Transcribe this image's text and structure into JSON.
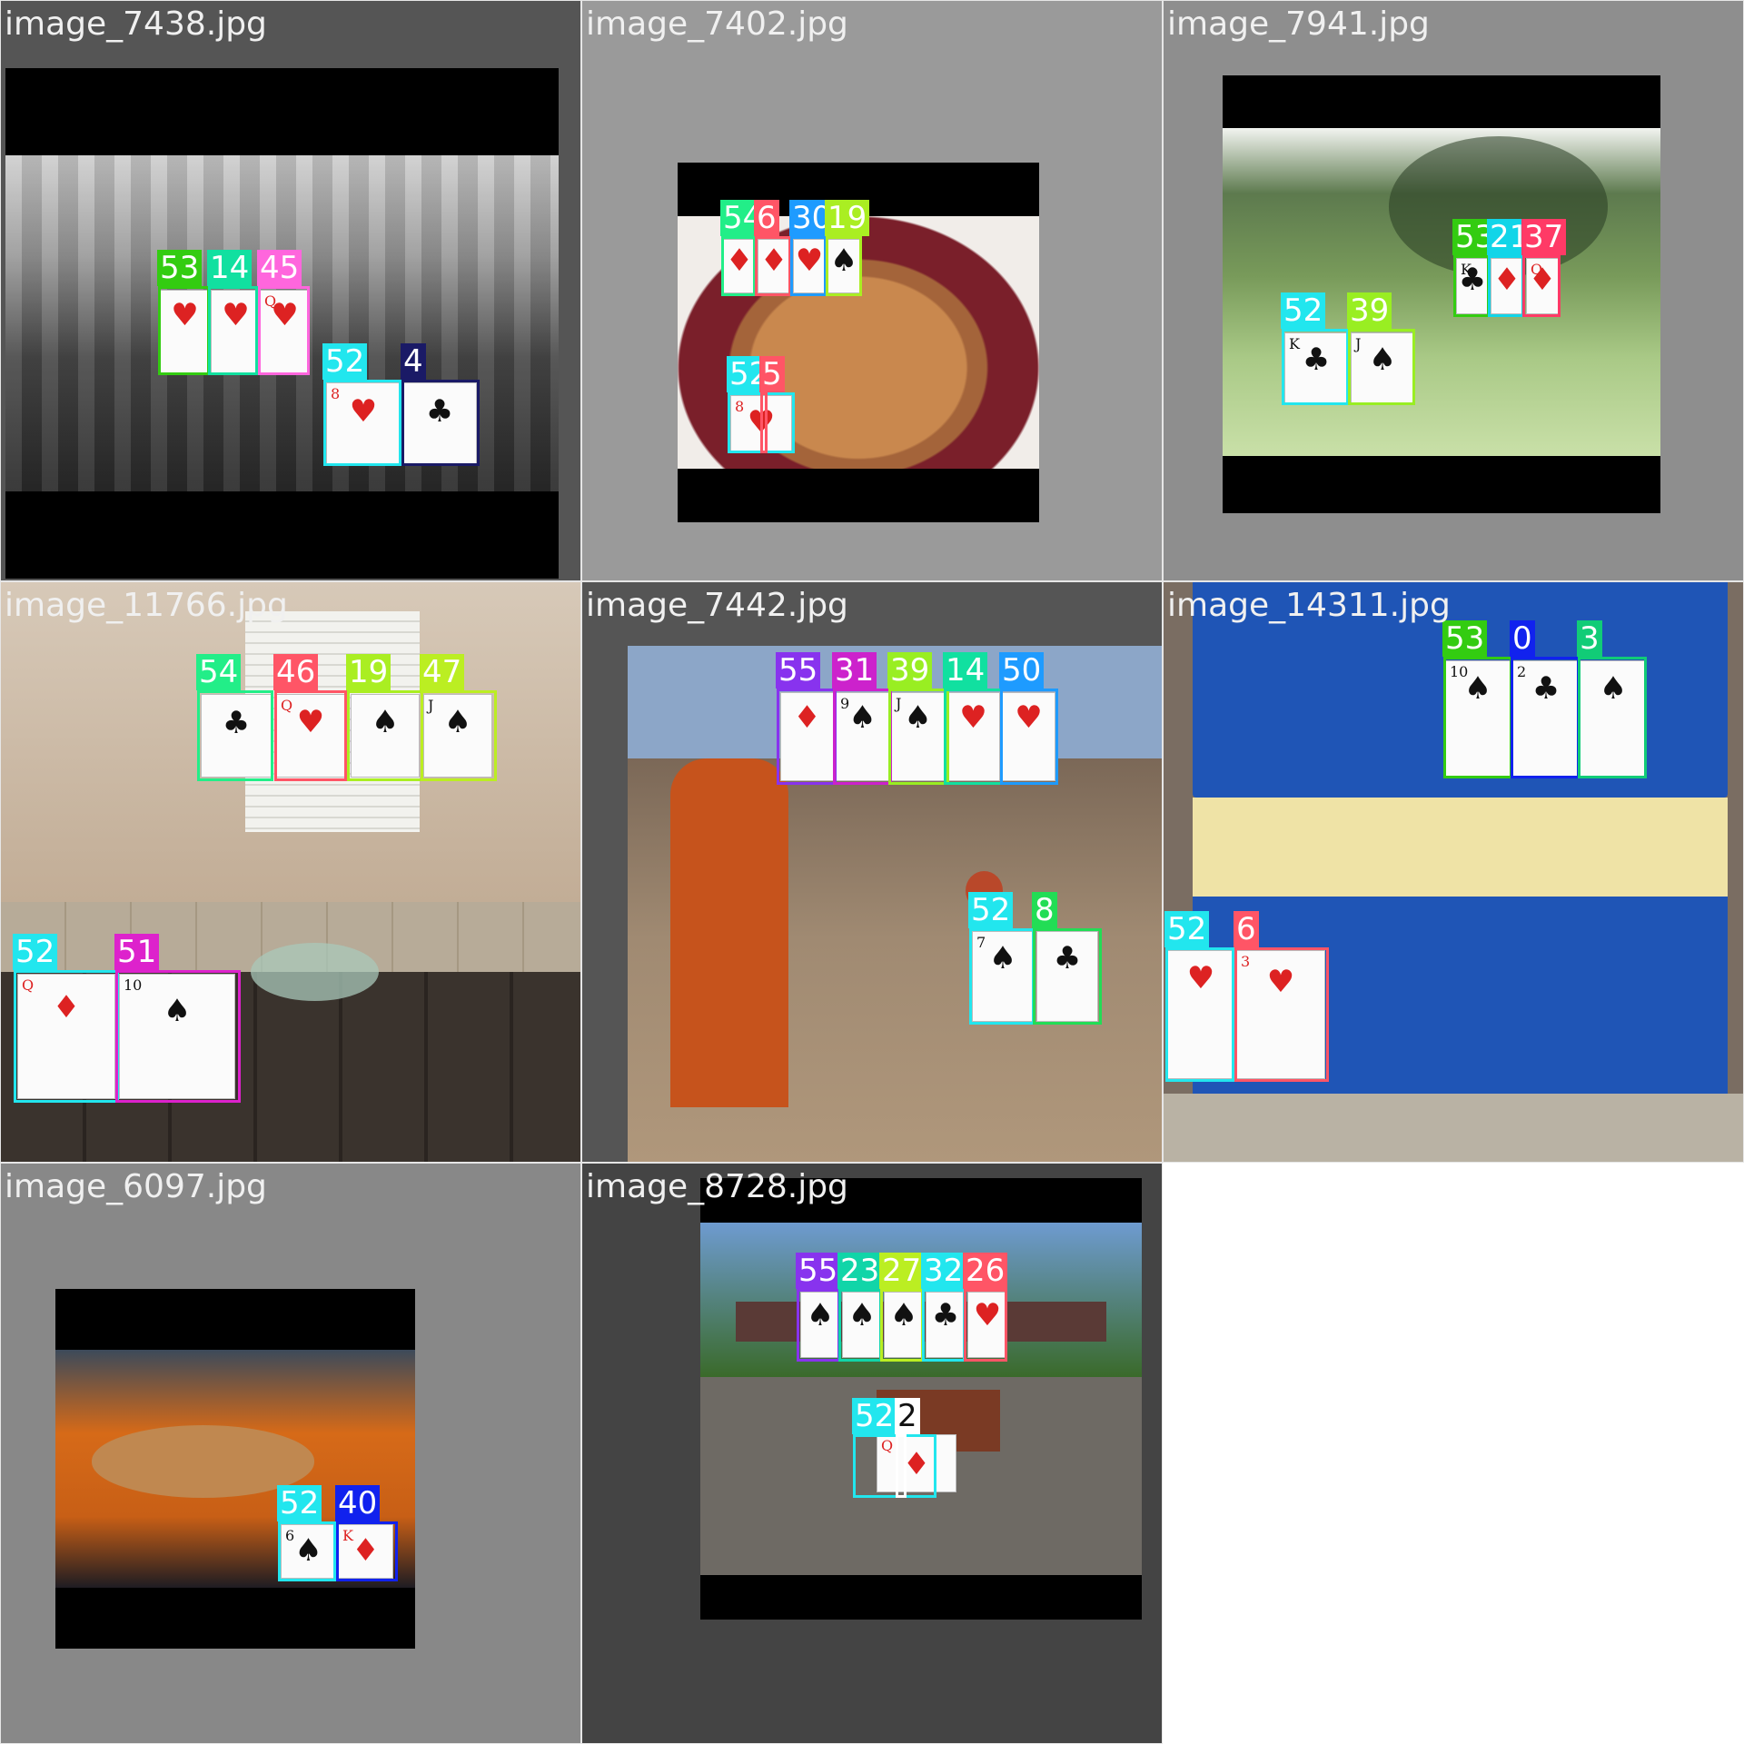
{
  "grid": {
    "tiles": [
      {
        "filename": "image_7438.jpg",
        "background_color": "#555555",
        "scene": "grayscale",
        "cards": [
          {
            "suit": "♥",
            "color": "red",
            "rank": ""
          },
          {
            "suit": "♥",
            "color": "red",
            "rank": ""
          },
          {
            "suit": "♥",
            "color": "red",
            "rank": "Q"
          },
          {
            "suit": "♥",
            "color": "red",
            "rank": "8"
          },
          {
            "suit": "♣",
            "color": "black",
            "rank": ""
          }
        ],
        "detections": [
          {
            "label": "53",
            "color": "#33cc11"
          },
          {
            "label": "14",
            "color": "#11e0a0"
          },
          {
            "label": "45",
            "color": "#ff66dd"
          },
          {
            "label": "52",
            "color": "#22e6ee"
          },
          {
            "label": "4",
            "color": "#1a1a66"
          }
        ]
      },
      {
        "filename": "image_7402.jpg",
        "background_color": "#9a9a9a",
        "scene": "pie",
        "cards": [
          {
            "suit": "♦",
            "color": "red",
            "rank": ""
          },
          {
            "suit": "♦",
            "color": "red",
            "rank": ""
          },
          {
            "suit": "♥",
            "color": "red",
            "rank": ""
          },
          {
            "suit": "♠",
            "color": "black",
            "rank": ""
          },
          {
            "suit": "♥",
            "color": "red",
            "rank": "8"
          }
        ],
        "detections": [
          {
            "label": "54",
            "color": "#22ee88"
          },
          {
            "label": "6",
            "color": "#ff5566"
          },
          {
            "label": "30",
            "color": "#1e9bff"
          },
          {
            "label": "19",
            "color": "#aaee22"
          },
          {
            "label": "52",
            "color": "#22e6ee"
          },
          {
            "label": "5",
            "color": "#ff5566"
          }
        ]
      },
      {
        "filename": "image_7941.jpg",
        "background_color": "#8e8e8e",
        "scene": "park",
        "cards": [
          {
            "suit": "♣",
            "color": "black",
            "rank": "K"
          },
          {
            "suit": "♦",
            "color": "red",
            "rank": ""
          },
          {
            "suit": "♦",
            "color": "red",
            "rank": "Q"
          },
          {
            "suit": "♣",
            "color": "black",
            "rank": "K"
          },
          {
            "suit": "♠",
            "color": "black",
            "rank": "J"
          }
        ],
        "detections": [
          {
            "label": "53",
            "color": "#33cc11"
          },
          {
            "label": "21",
            "color": "#11d5e8"
          },
          {
            "label": "37",
            "color": "#ff3a66"
          },
          {
            "label": "52",
            "color": "#22e6ee"
          },
          {
            "label": "39",
            "color": "#99ee22"
          }
        ]
      },
      {
        "filename": "image_11766.jpg",
        "background_color": "#000000",
        "scene": "bathroom",
        "cards": [
          {
            "suit": "♣",
            "color": "black",
            "rank": ""
          },
          {
            "suit": "♥",
            "color": "red",
            "rank": "Q"
          },
          {
            "suit": "♠",
            "color": "black",
            "rank": ""
          },
          {
            "suit": "♠",
            "color": "black",
            "rank": "J"
          },
          {
            "suit": "♦",
            "color": "red",
            "rank": "Q"
          },
          {
            "suit": "♠",
            "color": "black",
            "rank": "10"
          }
        ],
        "detections": [
          {
            "label": "54",
            "color": "#22ee88"
          },
          {
            "label": "46",
            "color": "#ff5566"
          },
          {
            "label": "19",
            "color": "#aaee22"
          },
          {
            "label": "47",
            "color": "#bbee22"
          },
          {
            "label": "52",
            "color": "#22e6ee"
          },
          {
            "label": "51",
            "color": "#dd22cc"
          }
        ]
      },
      {
        "filename": "image_7442.jpg",
        "background_color": "#555555",
        "scene": "street",
        "cards": [
          {
            "suit": "♦",
            "color": "red",
            "rank": ""
          },
          {
            "suit": "♠",
            "color": "black",
            "rank": "9"
          },
          {
            "suit": "♠",
            "color": "black",
            "rank": "J"
          },
          {
            "suit": "♥",
            "color": "red",
            "rank": ""
          },
          {
            "suit": "♥",
            "color": "red",
            "rank": ""
          },
          {
            "suit": "♠",
            "color": "black",
            "rank": "7"
          },
          {
            "suit": "♣",
            "color": "black",
            "rank": ""
          }
        ],
        "detections": [
          {
            "label": "55",
            "color": "#8833ee"
          },
          {
            "label": "31",
            "color": "#cc22cc"
          },
          {
            "label": "39",
            "color": "#99ee22"
          },
          {
            "label": "14",
            "color": "#11e0a0"
          },
          {
            "label": "50",
            "color": "#1e9bff"
          },
          {
            "label": "52",
            "color": "#22e6ee"
          },
          {
            "label": "8",
            "color": "#22dd55"
          }
        ]
      },
      {
        "filename": "image_14311.jpg",
        "background_color": "#2a5aa8",
        "scene": "bus",
        "cards": [
          {
            "suit": "♠",
            "color": "black",
            "rank": "10"
          },
          {
            "suit": "♣",
            "color": "black",
            "rank": "2"
          },
          {
            "suit": "♠",
            "color": "black",
            "rank": ""
          },
          {
            "suit": "♥",
            "color": "red",
            "rank": ""
          },
          {
            "suit": "♥",
            "color": "red",
            "rank": "3"
          }
        ],
        "detections": [
          {
            "label": "53",
            "color": "#33cc11"
          },
          {
            "label": "0",
            "color": "#1122ee"
          },
          {
            "label": "3",
            "color": "#11cc77"
          },
          {
            "label": "52",
            "color": "#22e6ee"
          },
          {
            "label": "6",
            "color": "#ff5566"
          }
        ]
      },
      {
        "filename": "image_6097.jpg",
        "background_color": "#888888",
        "scene": "cat",
        "cards": [
          {
            "suit": "♠",
            "color": "black",
            "rank": "6"
          },
          {
            "suit": "♦",
            "color": "red",
            "rank": "K"
          }
        ],
        "detections": [
          {
            "label": "52",
            "color": "#22e6ee"
          },
          {
            "label": "40",
            "color": "#1122ee"
          }
        ]
      },
      {
        "filename": "image_8728.jpg",
        "background_color": "#444444",
        "scene": "bench",
        "cards": [
          {
            "suit": "♠",
            "color": "black",
            "rank": ""
          },
          {
            "suit": "♠",
            "color": "black",
            "rank": ""
          },
          {
            "suit": "♠",
            "color": "black",
            "rank": ""
          },
          {
            "suit": "♣",
            "color": "black",
            "rank": ""
          },
          {
            "suit": "♥",
            "color": "red",
            "rank": ""
          },
          {
            "suit": "♦",
            "color": "red",
            "rank": "Q"
          }
        ],
        "detections": [
          {
            "label": "55",
            "color": "#8833ee"
          },
          {
            "label": "23",
            "color": "#11d5a8"
          },
          {
            "label": "27",
            "color": "#bbee22"
          },
          {
            "label": "32",
            "color": "#22e6ee"
          },
          {
            "label": "26",
            "color": "#ff5566"
          },
          {
            "label": "52",
            "color": "#22e6ee"
          },
          {
            "label": "2",
            "color": "#ffffff"
          }
        ]
      }
    ]
  }
}
